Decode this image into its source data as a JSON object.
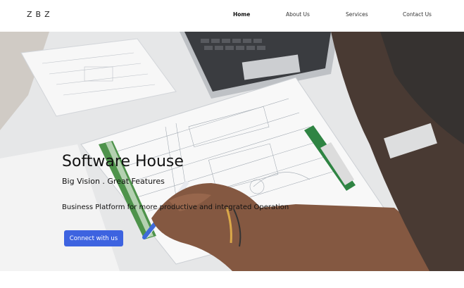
{
  "brand": {
    "logo_text": "ZBZ"
  },
  "nav": {
    "items": [
      {
        "label": "Home",
        "active": true
      },
      {
        "label": "About Us",
        "active": false
      },
      {
        "label": "Services",
        "active": false
      },
      {
        "label": "Contact Us",
        "active": false
      }
    ]
  },
  "hero": {
    "title": "Software House",
    "subtitle": "Big Vision . Great Features",
    "description": "Business Platform for more productive and integrated Operation",
    "cta_label": "Connect with us",
    "accent_color": "#3d63e0"
  }
}
